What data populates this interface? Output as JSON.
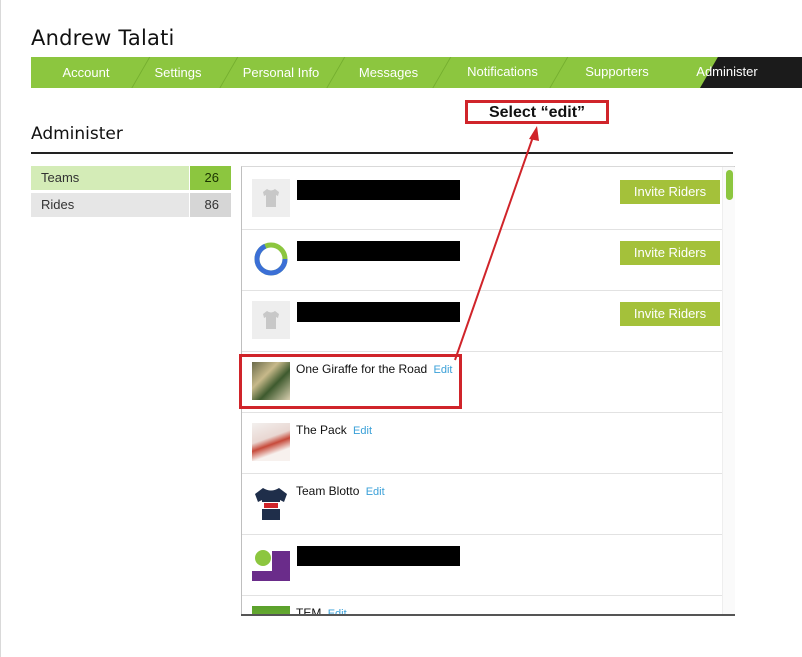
{
  "profile": {
    "name": "Andrew Talati"
  },
  "tabs": [
    {
      "label": "Account"
    },
    {
      "label": "Settings"
    },
    {
      "label": "Personal Info"
    },
    {
      "label": "Messages"
    },
    {
      "label": "Notifications"
    },
    {
      "label": "Supporters"
    },
    {
      "label": "Administer",
      "active": true
    }
  ],
  "section": {
    "title": "Administer"
  },
  "stats": [
    {
      "label": "Teams",
      "count": "26",
      "selected": true
    },
    {
      "label": "Rides",
      "count": "86"
    }
  ],
  "teams": [
    {
      "name": "",
      "redacted": true,
      "avatar": "shirt-placeholder-icon",
      "action": "Invite Riders"
    },
    {
      "name": "",
      "redacted": true,
      "avatar": "blue-ring-logo",
      "action": "Invite Riders"
    },
    {
      "name": "",
      "redacted": true,
      "avatar": "shirt-placeholder-icon",
      "action": "Invite Riders"
    },
    {
      "name": "One Giraffe for the Road",
      "edit": "Edit",
      "avatar": "group-photo"
    },
    {
      "name": "The Pack",
      "edit": "Edit",
      "avatar": "pack-photo"
    },
    {
      "name": "Team Blotto",
      "edit": "Edit",
      "avatar": "jersey-photo"
    },
    {
      "name": "",
      "redacted": true,
      "avatar": "ride-sustainable-logo"
    },
    {
      "name": "TEM",
      "edit": "Edit",
      "avatar": "green-logo"
    }
  ],
  "annotation": {
    "callout_text": "Select “edit”"
  },
  "colors": {
    "tab_green": "#8cc63f",
    "tab_active": "#1b1b1b",
    "button_green": "#a4c13a",
    "edit_link": "#3aa0d8",
    "annotation_red": "#d0242a"
  }
}
